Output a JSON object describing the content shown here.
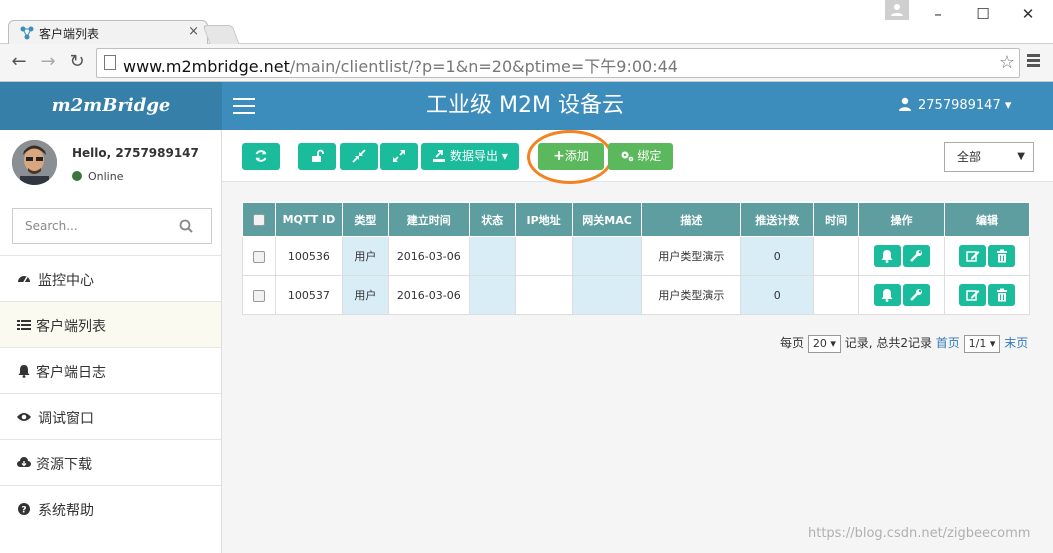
{
  "browser": {
    "tab_title": "客户端列表",
    "tab_close": "×",
    "url_host": "www.m2mbridge.net",
    "url_path": "/main/clientlist/?p=1&n=20&ptime=下午9:00:44",
    "win_minimize": "–",
    "win_maximize": "☐",
    "win_close": "✕"
  },
  "header": {
    "logo": "m2mBridge",
    "title": "工业级 M2M 设备云",
    "user": "2757989147"
  },
  "sidebar": {
    "greeting": "Hello, 2757989147",
    "status": "Online",
    "search_placeholder": "Search...",
    "items": [
      {
        "label": "监控中心",
        "icon": "dashboard-icon"
      },
      {
        "label": "客户端列表",
        "icon": "list-icon"
      },
      {
        "label": "客户端日志",
        "icon": "bell-icon"
      },
      {
        "label": "调试窗口",
        "icon": "eye-icon"
      },
      {
        "label": "资源下载",
        "icon": "cloud-download-icon"
      },
      {
        "label": "系统帮助",
        "icon": "question-icon"
      }
    ]
  },
  "toolbar": {
    "export_label": "数据导出",
    "add_label": "添加",
    "bind_label": "绑定",
    "filter_value": "全部"
  },
  "table": {
    "headers": [
      "MQTT ID",
      "类型",
      "建立时间",
      "状态",
      "IP地址",
      "网关MAC",
      "描述",
      "推送计数",
      "时间",
      "操作",
      "编辑"
    ],
    "rows": [
      {
        "id": "100536",
        "type": "用户",
        "created": "2016-03-06",
        "status": "",
        "ip": "",
        "mac": "",
        "desc": "用户类型演示",
        "count": "0",
        "time": ""
      },
      {
        "id": "100537",
        "type": "用户",
        "created": "2016-03-06",
        "status": "",
        "ip": "",
        "mac": "",
        "desc": "用户类型演示",
        "count": "0",
        "time": ""
      }
    ]
  },
  "pager": {
    "per_page_label": "每页",
    "per_page": "20",
    "summary": "记录, 总共2记录",
    "first": "首页",
    "page": "1/1",
    "last": "末页"
  },
  "watermark": "https://blog.csdn.net/zigbeecomm"
}
